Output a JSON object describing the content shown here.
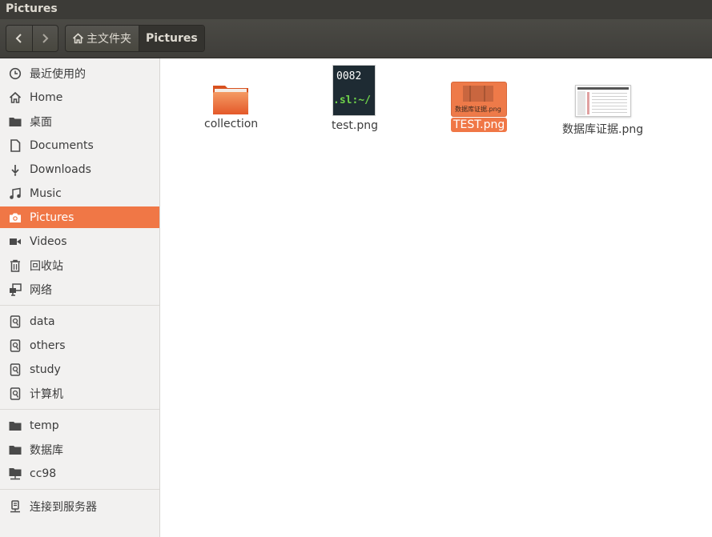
{
  "window": {
    "title": "Pictures"
  },
  "toolbar": {
    "back_icon": "chevron-left",
    "forward_icon": "chevron-right",
    "breadcrumb": [
      {
        "label": "主文件夹",
        "icon": "home-icon"
      },
      {
        "label": "Pictures"
      }
    ]
  },
  "sidebar": {
    "items": [
      {
        "label": "最近使用的",
        "icon": "clock-icon"
      },
      {
        "label": "Home",
        "icon": "home-icon"
      },
      {
        "label": "桌面",
        "icon": "folder-icon"
      },
      {
        "label": "Documents",
        "icon": "document-icon"
      },
      {
        "label": "Downloads",
        "icon": "download-icon"
      },
      {
        "label": "Music",
        "icon": "music-icon"
      },
      {
        "label": "Pictures",
        "icon": "camera-icon",
        "active": true
      },
      {
        "label": "Videos",
        "icon": "video-icon"
      },
      {
        "label": "回收站",
        "icon": "trash-icon"
      },
      {
        "label": "网络",
        "icon": "network-icon"
      },
      {
        "label": "data",
        "icon": "drive-icon"
      },
      {
        "label": "others",
        "icon": "drive-icon"
      },
      {
        "label": "study",
        "icon": "drive-icon"
      },
      {
        "label": "计算机",
        "icon": "drive-icon"
      },
      {
        "label": "temp",
        "icon": "folder-icon"
      },
      {
        "label": "数据库",
        "icon": "folder-icon"
      },
      {
        "label": "cc98",
        "icon": "network-folder-icon"
      },
      {
        "label": "连接到服务器",
        "icon": "server-connect-icon"
      }
    ]
  },
  "files": [
    {
      "name": "collection",
      "type": "folder"
    },
    {
      "name": "test.png",
      "type": "image",
      "thumb_text": [
        "0082",
        ".sl:~/"
      ]
    },
    {
      "name": "TEST.png",
      "type": "image",
      "selected": true,
      "thumb_caption": "数据库证据.png"
    },
    {
      "name": "数据库证据.png",
      "type": "image"
    }
  ],
  "colors": {
    "accent": "#f07746",
    "titlebar": "#3c3b37",
    "sidebar_bg": "#f2f1f0"
  }
}
